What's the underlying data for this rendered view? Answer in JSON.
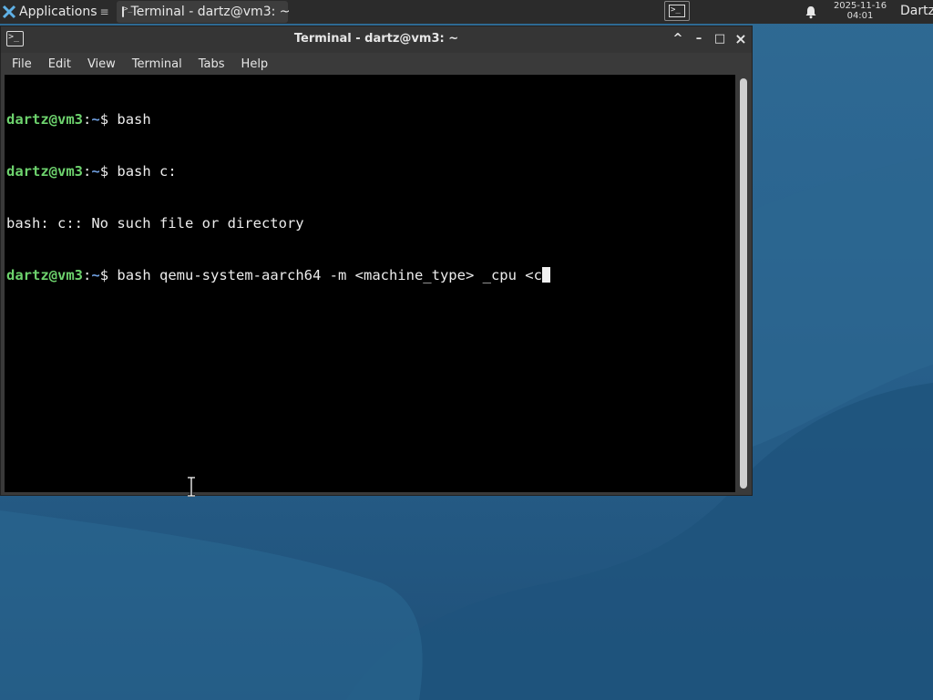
{
  "panel": {
    "applications_label": "Applications",
    "task_label": "Terminal - dartz@vm3: ~",
    "clock_date": "2025-11-16",
    "clock_time": "04:01",
    "user_name": "Dartz"
  },
  "window": {
    "title": "Terminal - dartz@vm3: ~",
    "controls": {
      "up": "^",
      "minimize": "–",
      "maximize": "□",
      "close": "×"
    },
    "menu": [
      "File",
      "Edit",
      "View",
      "Terminal",
      "Tabs",
      "Help"
    ]
  },
  "terminal": {
    "prompt_user": "dartz@vm3",
    "prompt_colon": ":",
    "prompt_dir": "~",
    "prompt_symbol": "$ ",
    "lines": [
      {
        "type": "prompt",
        "command": "bash"
      },
      {
        "type": "prompt",
        "command": "bash c:"
      },
      {
        "type": "output",
        "text": "bash: c:: No such file or directory"
      },
      {
        "type": "prompt",
        "command": "bash qemu-system-aarch64 -m <machine_type> _cpu <c",
        "cursor": true
      }
    ]
  },
  "icons": {
    "applications": "applications-icon",
    "task": "terminal-icon",
    "launcher": "terminal-launcher-icon",
    "notifications": "bell-icon",
    "window": "terminal-icon",
    "pointer": "ibeam-cursor-icon"
  },
  "colors": {
    "panel_bg": "#2b2b2b",
    "terminal_bg": "#000000",
    "prompt_user": "#6dd26d",
    "prompt_dir": "#6f9fe0",
    "desktop": "#2a6490"
  }
}
